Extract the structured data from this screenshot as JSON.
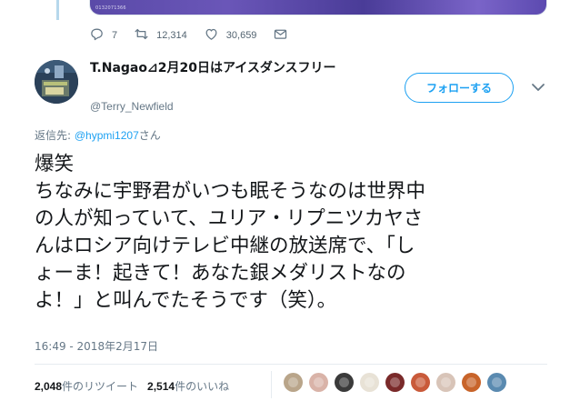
{
  "previous_tweet": {
    "media_caption": "0132071366",
    "actions": {
      "replies": "7",
      "retweets": "12,314",
      "likes": "30,659"
    }
  },
  "tweet": {
    "author_name": "T.Nagao⊿2月20日はアイスダンスフリー",
    "handle": "@Terry_Newfield",
    "follow_label": "フォローする",
    "reply_prefix": "返信先: ",
    "reply_mention": "@hypmi1207",
    "reply_suffix": "さん",
    "text_lines": [
      "爆笑",
      "ちなみに宇野君がいつも眠そうなのは世界中",
      "の人が知っていて、ユリア・リプニツカヤさ",
      "んはロシア向けテレビ中継の放送席で、「し",
      "ょーま！起きて！あなた銀メダリストなの",
      "よ！」と叫んでたそうです（笑）。"
    ],
    "timestamp": "16:49 - 2018年2月17日",
    "retweet_count": "2,048",
    "retweet_label": "件のリツイート",
    "like_count": "2,514",
    "like_label": "件のいいね"
  },
  "icons": {
    "reply": "reply-icon",
    "retweet": "retweet-icon",
    "like": "heart-icon",
    "dm": "envelope-icon",
    "more": "chevron-down-icon"
  },
  "colors": {
    "accent": "#1da1f2",
    "muted": "#657786",
    "thread_line": "#b6d8ec"
  },
  "likers_colors": [
    "#b9a58a",
    "#d9b3a8",
    "#3a3a3a",
    "#e8e2d6",
    "#7a2a2a",
    "#c95a3a",
    "#d8c4b8",
    "#c8642a",
    "#5a8ab0"
  ]
}
